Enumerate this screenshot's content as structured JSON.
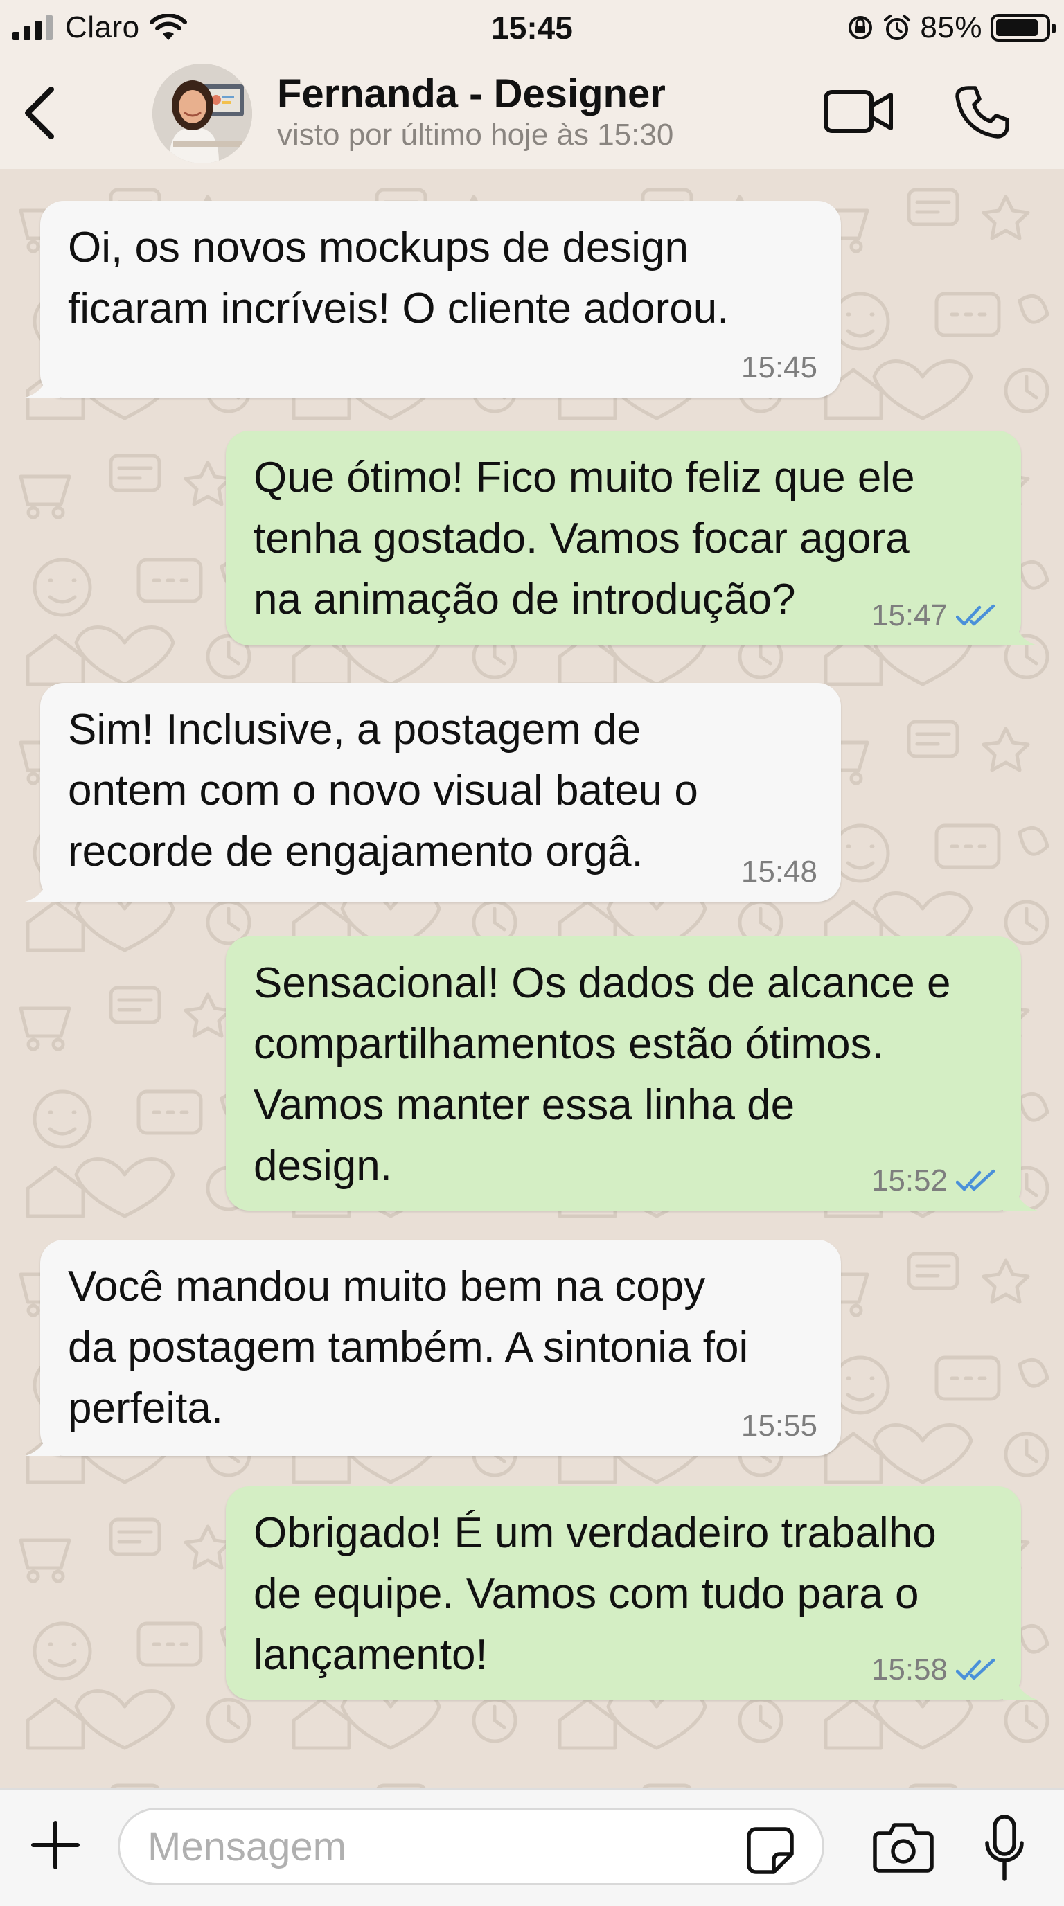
{
  "status_bar": {
    "carrier": "Claro",
    "time": "15:45",
    "battery": "85%",
    "battery_level": 0.85,
    "icons": [
      "signal-icon",
      "wifi-icon",
      "orientation-lock-icon",
      "alarm-icon",
      "battery-icon"
    ]
  },
  "header": {
    "contact_name": "Fernanda - Designer",
    "last_seen": "visto por último hoje às 15:30",
    "icons": [
      "back-chevron-icon",
      "video-call-icon",
      "phone-call-icon"
    ]
  },
  "messages": [
    {
      "direction": "incoming",
      "lines": [
        "Oi, os novos mockups de design",
        "ficaram incríveis! O cliente adorou."
      ],
      "time": "15:45"
    },
    {
      "direction": "outgoing",
      "lines": [
        "Que ótimo! Fico muito feliz que ele",
        "tenha gostado. Vamos focar agora",
        "na animação de introdução?"
      ],
      "time": "15:47",
      "read": true
    },
    {
      "direction": "incoming",
      "lines": [
        "Sim! Inclusive, a postagem de",
        "ontem com o novo visual bateu o",
        "recorde de engajamento orgâ."
      ],
      "time": "15:48"
    },
    {
      "direction": "outgoing",
      "lines": [
        "Sensacional! Os dados de alcance e",
        "compartilhamentos estão ótimos.",
        "Vamos manter essa linha de",
        "design."
      ],
      "time": "15:52",
      "read": true
    },
    {
      "direction": "incoming",
      "lines": [
        "Você mandou muito bem na copy",
        "da postagem também. A sintonia foi",
        "perfeita."
      ],
      "time": "15:55"
    },
    {
      "direction": "outgoing",
      "lines": [
        "Obrigado! É um verdadeiro trabalho",
        "de equipe. Vamos com tudo para o",
        "lançamento!"
      ],
      "time": "15:58",
      "read": true
    }
  ],
  "composer": {
    "placeholder": "Mensagem",
    "value": "",
    "icons": [
      "plus-icon",
      "sticker-icon",
      "camera-icon",
      "microphone-icon"
    ]
  },
  "colors": {
    "incoming_bubble": "#f7f7f7",
    "outgoing_bubble": "#d4eec4",
    "read_ticks": "#4a90d9",
    "wallpaper": "#e9dfd6",
    "header_bg": "#f3ede7"
  }
}
